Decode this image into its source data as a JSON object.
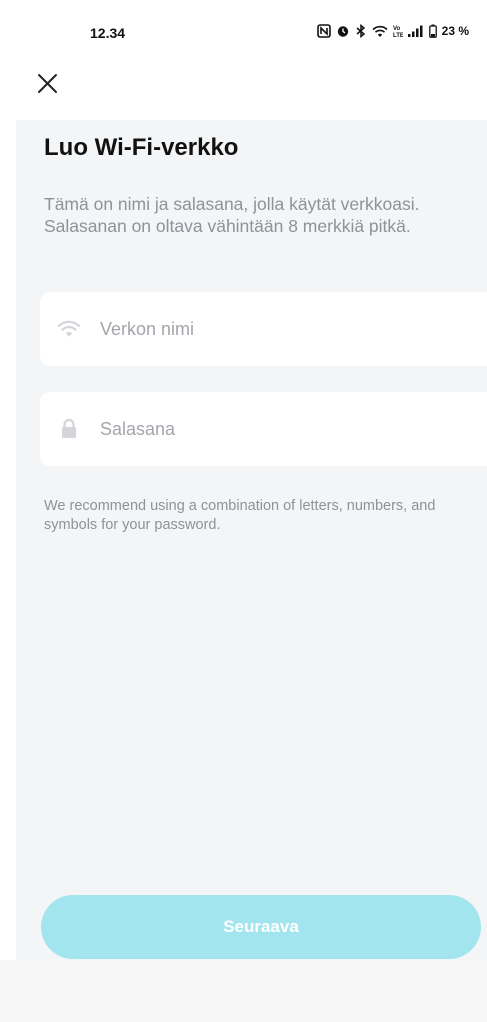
{
  "status_bar": {
    "time": "12.34",
    "battery": "23 %",
    "icons": [
      "nfc-icon",
      "alarm-icon",
      "bluetooth-icon",
      "wifi-icon",
      "volte-icon",
      "signal-icon",
      "battery-icon"
    ]
  },
  "header": {
    "close_icon": "close-icon"
  },
  "main": {
    "title": "Luo Wi-Fi-verkko",
    "description": "Tämä on nimi ja salasana, jolla käytät verkkoasi. Salasanan on oltava vähintään 8 merkkiä pitkä.",
    "network_name": {
      "placeholder": "Verkon nimi",
      "value": "",
      "icon": "wifi-icon"
    },
    "password": {
      "placeholder": "Salasana",
      "value": "",
      "icon": "lock-icon"
    },
    "password_hint": "We recommend using a combination of letters, numbers, and symbols for your password."
  },
  "footer": {
    "next_label": "Seuraava"
  },
  "colors": {
    "accent_disabled": "#a3e5ee",
    "background": "#f4f5f7",
    "text_primary": "#111111",
    "text_secondary": "#8e9299"
  }
}
